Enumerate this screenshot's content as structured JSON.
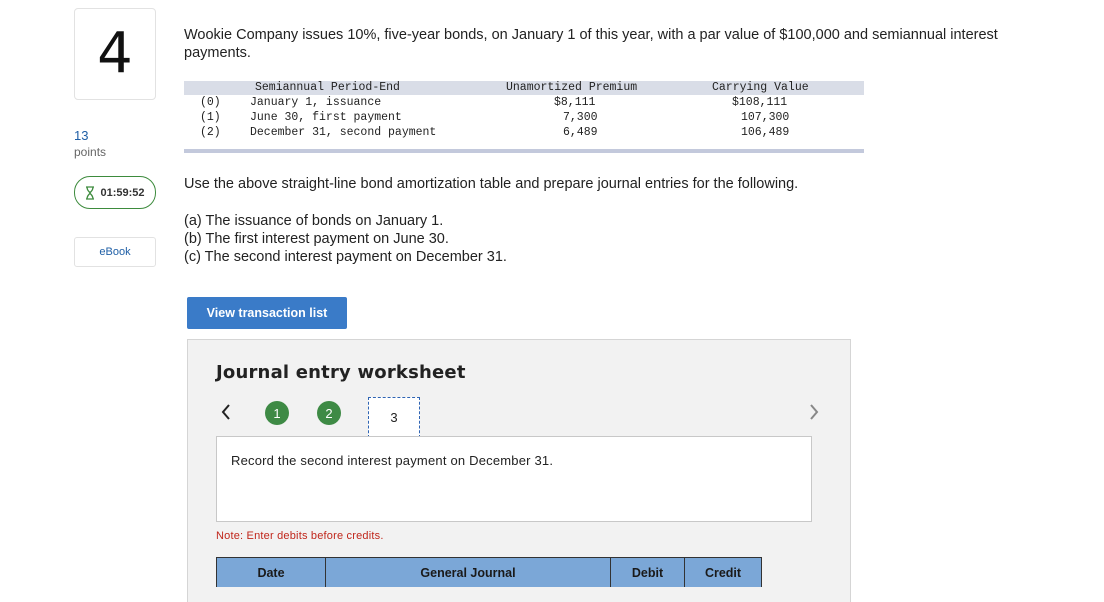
{
  "question": {
    "number": "4",
    "points_value": "13",
    "points_label": "points",
    "timer": "01:59:52",
    "ebook_label": "eBook",
    "text": "Wookie Company issues 10%, five-year bonds, on January 1 of this year, with a par value of $100,000 and semiannual interest payments."
  },
  "amortization_table": {
    "headers": [
      "Semiannual Period-End",
      "Unamortized Premium",
      "Carrying Value"
    ],
    "rows": [
      {
        "period": "(0)",
        "label": "January 1, issuance",
        "premium": "$8,111",
        "carrying": "$108,111"
      },
      {
        "period": "(1)",
        "label": "June 30, first payment",
        "premium": "7,300",
        "carrying": "107,300"
      },
      {
        "period": "(2)",
        "label": "December 31, second payment",
        "premium": "6,489",
        "carrying": "106,489"
      }
    ]
  },
  "instruction": "Use the above straight-line bond amortization table and prepare journal entries for the following.",
  "parts": [
    "(a) The issuance of bonds on January 1.",
    "(b) The first interest payment on June 30.",
    "(c) The second interest payment on December 31."
  ],
  "view_transaction_button": "View transaction list",
  "worksheet": {
    "title": "Journal entry worksheet",
    "steps": [
      "1",
      "2",
      "3"
    ],
    "active_step": "3",
    "record_text": "Record the second interest payment on December 31.",
    "note": "Note: Enter debits before credits.",
    "columns": [
      "Date",
      "General Journal",
      "Debit",
      "Credit"
    ]
  },
  "colors": {
    "step_complete": "#3e8a45",
    "button_primary": "#3a7bc8",
    "table_header": "#7ba7d7",
    "note_red": "#c0261b",
    "link_blue": "#1f5fa6"
  }
}
